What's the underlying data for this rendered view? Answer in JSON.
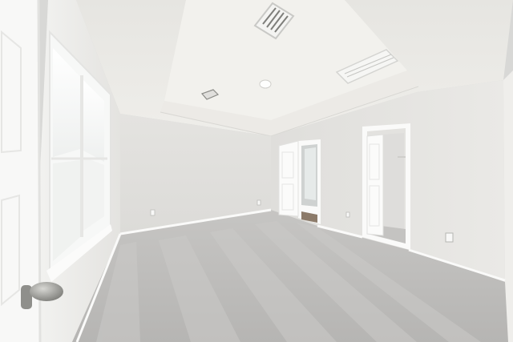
{
  "scene": {
    "subject": "empty-carpeted-bedroom",
    "colors": {
      "ceiling": "#ecebe7",
      "tray_ceiling": "#f1f0ec",
      "wall_left": "#ecebe8",
      "wall_back": "#e6e5e2",
      "wall_right": "#e3e2df",
      "carpet": "#bdbcba",
      "carpet_stripe": "#c9c8c6",
      "trim": "#fbfbfa",
      "door": "#f6f6f5",
      "window_glass": "#f4f6f5",
      "knob": "#9a9a96"
    },
    "icons": [
      "hvac-vent-icon",
      "recessed-light-icon",
      "door-knob-icon",
      "outlet-icon"
    ]
  }
}
